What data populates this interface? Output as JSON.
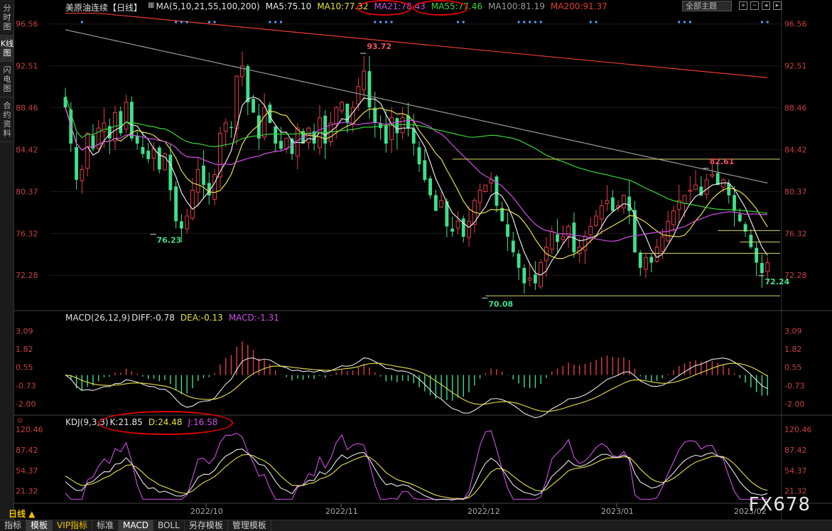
{
  "side_tabs": [
    {
      "label": "分时图",
      "active": false
    },
    {
      "label": "K线图",
      "active": true
    },
    {
      "label": "闪电图",
      "active": false
    },
    {
      "label": "合约资料",
      "active": false
    }
  ],
  "header": {
    "title": "美原油连续【日线】",
    "ma_label": "MA(5,10,21,55,100,200)",
    "theme_button": "全部主题",
    "ma": [
      {
        "label": "MA5:75.10",
        "color": "#e8e8e8"
      },
      {
        "label": "MA10:77.32",
        "color": "#e8e04a"
      },
      {
        "label": "MA21:78.43",
        "color": "#d24fe8"
      },
      {
        "label": "MA55:77.46",
        "color": "#3ad43a"
      },
      {
        "label": "MA100:81.19",
        "color": "#9a9a9a"
      },
      {
        "label": "MA200:91.37",
        "color": "#e63c2e"
      }
    ]
  },
  "price_axis": {
    "ticks": [
      "96.56",
      "92.51",
      "88.46",
      "84.42",
      "80.37",
      "76.32",
      "72.28"
    ],
    "high_label": "93.72",
    "low_label": "70.08",
    "left_low_label": "76.23",
    "recent_high_label": "82.61",
    "recent_low_label": "72.24"
  },
  "macd": {
    "title": "MACD(26,12,9)",
    "diff": "DIFF:-0.78",
    "dea": "DEA:-0.13",
    "macd": "MACD:-1.31",
    "ticks": [
      "3.09",
      "1.82",
      "0.55",
      "-0.73",
      "-2.00"
    ]
  },
  "kdj": {
    "title": "KDJ(9,3,3)",
    "k": "K:21.85",
    "d": "D:24.48",
    "j": "J:16.58",
    "ticks": [
      "120.46",
      "87.42",
      "54.37",
      "21.32"
    ]
  },
  "date_labels": [
    "2022/10",
    "2022/11",
    "2022/12",
    "2023/01",
    "2023/02"
  ],
  "period_button": "日线 ▲",
  "watermark": "FX678",
  "bottom_tabs": [
    {
      "label": "指标",
      "active": false
    },
    {
      "label": "模板",
      "active": true
    },
    {
      "label": "VIP指标",
      "active": false,
      "vip": true
    },
    {
      "label": "标准",
      "active": false
    },
    {
      "label": "MACD",
      "active": true
    },
    {
      "label": "BOLL",
      "active": false
    },
    {
      "label": "另存模板",
      "active": false
    },
    {
      "label": "管理模板",
      "active": false
    }
  ],
  "colors": {
    "up": "#e63c4c",
    "down": "#3ee08c",
    "ma5": "#e8e8e8",
    "ma10": "#e8e04a",
    "ma21": "#d24fe8",
    "ma55": "#3ad43a",
    "ma100": "#9a9a9a",
    "ma200": "#e63c2e",
    "annotation": "#e00000"
  },
  "chart_data": {
    "type": "candlestick",
    "title": "美原油连续【日线】",
    "x_labels": [
      "2022/10",
      "2022/11",
      "2022/12",
      "2023/01",
      "2023/02"
    ],
    "price_range": [
      69.0,
      97.5
    ],
    "closes": [
      88.5,
      85.0,
      81.5,
      82.5,
      86.0,
      84.5,
      86.5,
      87.0,
      85.5,
      88.0,
      86.0,
      89.0,
      85.5,
      85.0,
      84.0,
      83.5,
      84.5,
      82.5,
      84.0,
      80.5,
      77.5,
      76.8,
      78.0,
      80.5,
      82.5,
      81.0,
      80.0,
      82.0,
      86.0,
      87.0,
      86.5,
      91.5,
      92.5,
      89.0,
      88.0,
      85.5,
      88.5,
      87.0,
      85.0,
      84.5,
      85.5,
      84.0,
      86.5,
      85.0,
      86.5,
      85.0,
      87.5,
      85.0,
      87.0,
      88.5,
      89.0,
      87.0,
      88.5,
      90.5,
      92.0,
      88.5,
      87.0,
      86.5,
      85.0,
      87.5,
      86.0,
      87.5,
      86.5,
      85.0,
      83.0,
      81.5,
      80.0,
      78.5,
      79.5,
      77.0,
      76.5,
      77.5,
      76.0,
      77.5,
      79.5,
      80.5,
      81.0,
      81.5,
      79.0,
      77.5,
      76.0,
      74.5,
      73.0,
      71.5,
      72.0,
      71.5,
      73.5,
      75.0,
      76.5,
      75.5,
      76.0,
      77.0,
      74.5,
      75.0,
      76.0,
      77.0,
      78.0,
      79.0,
      79.5,
      78.5,
      79.0,
      80.0,
      78.5,
      74.5,
      73.0,
      74.0,
      73.5,
      75.0,
      76.0,
      77.5,
      78.5,
      79.5,
      80.0,
      80.5,
      81.0,
      80.0,
      81.5,
      82.0,
      81.0,
      81.5,
      80.0,
      78.5,
      77.5,
      76.5,
      75.0,
      73.5,
      72.5,
      73.5
    ],
    "ma": {
      "MA5": 75.1,
      "MA10": 77.32,
      "MA21": 78.43,
      "MA55": 77.46,
      "MA100": 81.19,
      "MA200": 91.37
    },
    "annotated_values": {
      "high": 93.72,
      "low": 70.08,
      "early_low": 76.23,
      "recent_high": 82.61,
      "latest_low": 72.24
    },
    "macd": {
      "DIFF": -0.78,
      "DEA": -0.13,
      "MACD": -1.31,
      "range": [
        -2.6,
        3.6
      ]
    },
    "kdj": {
      "K": 21.85,
      "D": 24.48,
      "J": 16.58,
      "range": [
        5,
        125
      ]
    },
    "horizontal_levels": [
      83.5,
      76.6,
      74.4,
      75.5,
      70.3
    ]
  }
}
